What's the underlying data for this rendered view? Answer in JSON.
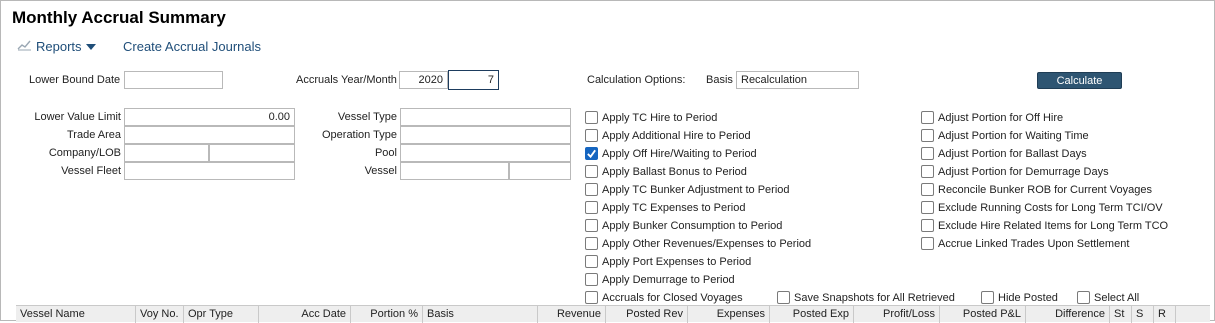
{
  "page": {
    "title": "Monthly Accrual Summary"
  },
  "menu": {
    "reports_label": "Reports",
    "create_journals_label": "Create Accrual Journals"
  },
  "filters": {
    "lower_bound_date_label": "Lower Bound Date",
    "lower_bound_date_value": "",
    "accruals_year_month_label": "Accruals Year/Month",
    "year_value": "2020",
    "month_value": "7",
    "calculation_options_label": "Calculation Options:",
    "basis_label": "Basis",
    "basis_value": "Recalculation",
    "calculate_label": "Calculate",
    "lower_value_limit_label": "Lower Value Limit",
    "lower_value_limit_value": "0.00",
    "trade_area_label": "Trade Area",
    "trade_area_value": "",
    "company_lob_label": "Company/LOB",
    "company_value": "",
    "lob_value": "",
    "vessel_fleet_label": "Vessel Fleet",
    "vessel_fleet_value": "",
    "vessel_type_label": "Vessel Type",
    "vessel_type_value": "",
    "operation_type_label": "Operation Type",
    "operation_type_value": "",
    "pool_label": "Pool",
    "pool_value": "",
    "vessel_label": "Vessel",
    "vessel_value": "",
    "vessel_value2": ""
  },
  "options_left": [
    {
      "label": "Apply TC Hire to Period",
      "checked": false
    },
    {
      "label": "Apply Additional Hire to Period",
      "checked": false
    },
    {
      "label": "Apply Off Hire/Waiting to Period",
      "checked": true
    },
    {
      "label": "Apply Ballast Bonus to Period",
      "checked": false
    },
    {
      "label": "Apply TC Bunker Adjustment to Period",
      "checked": false
    },
    {
      "label": "Apply TC Expenses to Period",
      "checked": false
    },
    {
      "label": "Apply Bunker Consumption to Period",
      "checked": false
    },
    {
      "label": "Apply Other Revenues/Expenses to Period",
      "checked": false
    },
    {
      "label": "Apply Port Expenses to Period",
      "checked": false
    },
    {
      "label": "Apply Demurrage to Period",
      "checked": false
    },
    {
      "label": "Accruals for Closed Voyages",
      "checked": false
    }
  ],
  "options_right": [
    {
      "label": "Adjust Portion for Off Hire",
      "checked": false
    },
    {
      "label": "Adjust Portion for Waiting Time",
      "checked": false
    },
    {
      "label": "Adjust Portion for Ballast Days",
      "checked": false
    },
    {
      "label": "Adjust Portion for Demurrage Days",
      "checked": false
    },
    {
      "label": "Reconcile Bunker ROB for Current Voyages",
      "checked": false
    },
    {
      "label": "Exclude Running Costs for Long Term TCI/OV",
      "checked": false
    },
    {
      "label": "Exclude Hire Related Items for Long Term TCO",
      "checked": false
    },
    {
      "label": "Accrue Linked Trades Upon Settlement",
      "checked": false
    }
  ],
  "bottom_options": {
    "save_snapshots_label": "Save Snapshots for All Retrieved",
    "save_snapshots_checked": false,
    "hide_posted_label": "Hide Posted",
    "hide_posted_checked": false,
    "select_all_label": "Select All",
    "select_all_checked": false
  },
  "grid": {
    "columns": [
      "Vessel Name",
      "Voy No.",
      "Opr Type",
      "Acc Date",
      "Portion %",
      "Basis",
      "Revenue",
      "Posted Rev",
      "Expenses",
      "Posted Exp",
      "Profit/Loss",
      "Posted P&L",
      "Difference",
      "St",
      "S",
      "R"
    ]
  },
  "colors": {
    "accent": "#1f4e79",
    "button": "#2e5572",
    "checkbox_checked": "#1565c0"
  },
  "icons": {
    "reports": "chart-line-icon",
    "dropdown": "caret-down-icon",
    "check": "check-icon"
  }
}
